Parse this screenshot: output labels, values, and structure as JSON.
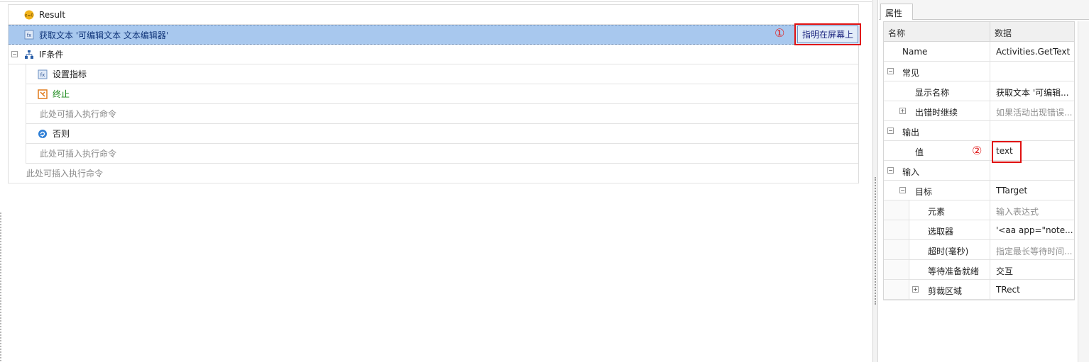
{
  "workflow": {
    "rows": [
      {
        "label": "Result",
        "icon": "result-icon"
      },
      {
        "label": "获取文本 '可编辑文本 文本编辑器'",
        "icon": "get-text-icon"
      },
      {
        "label": "IF条件",
        "icon": "if-icon"
      },
      {
        "label": "设置指标",
        "icon": "set-indicator-icon"
      },
      {
        "label": "终止",
        "icon": "terminate-icon"
      },
      {
        "label": "此处可插入执行命令"
      },
      {
        "label": "否则",
        "icon": "else-icon"
      },
      {
        "label": "此处可插入执行命令"
      },
      {
        "label": "此处可插入执行命令"
      }
    ],
    "highlight_button": "指明在屏幕上",
    "marker1": "①",
    "marker2": "②"
  },
  "properties": {
    "tab": "属性",
    "col_name": "名称",
    "col_value": "数据",
    "rows": [
      {
        "name": "Name",
        "value": "Activities.GetText"
      },
      {
        "name": "常见",
        "value": ""
      },
      {
        "name": "显示名称",
        "value": "获取文本 '可编辑..."
      },
      {
        "name": "出错时继续",
        "value": "如果活动出现错误..."
      },
      {
        "name": "输出",
        "value": ""
      },
      {
        "name": "值",
        "value": "text"
      },
      {
        "name": "输入",
        "value": ""
      },
      {
        "name": "目标",
        "value": "TTarget"
      },
      {
        "name": "元素",
        "value": "输入表达式"
      },
      {
        "name": "选取器",
        "value": "'<aa app=\"note..."
      },
      {
        "name": "超时(毫秒)",
        "value": "指定最长等待时间..."
      },
      {
        "name": "等待准备就绪",
        "value": "交互"
      },
      {
        "name": "剪裁区域",
        "value": "TRect"
      }
    ]
  },
  "colors": {
    "selected_row": "#a8c8ee",
    "annotation_red": "#e01010",
    "terminate_green": "#1b8a1b"
  }
}
